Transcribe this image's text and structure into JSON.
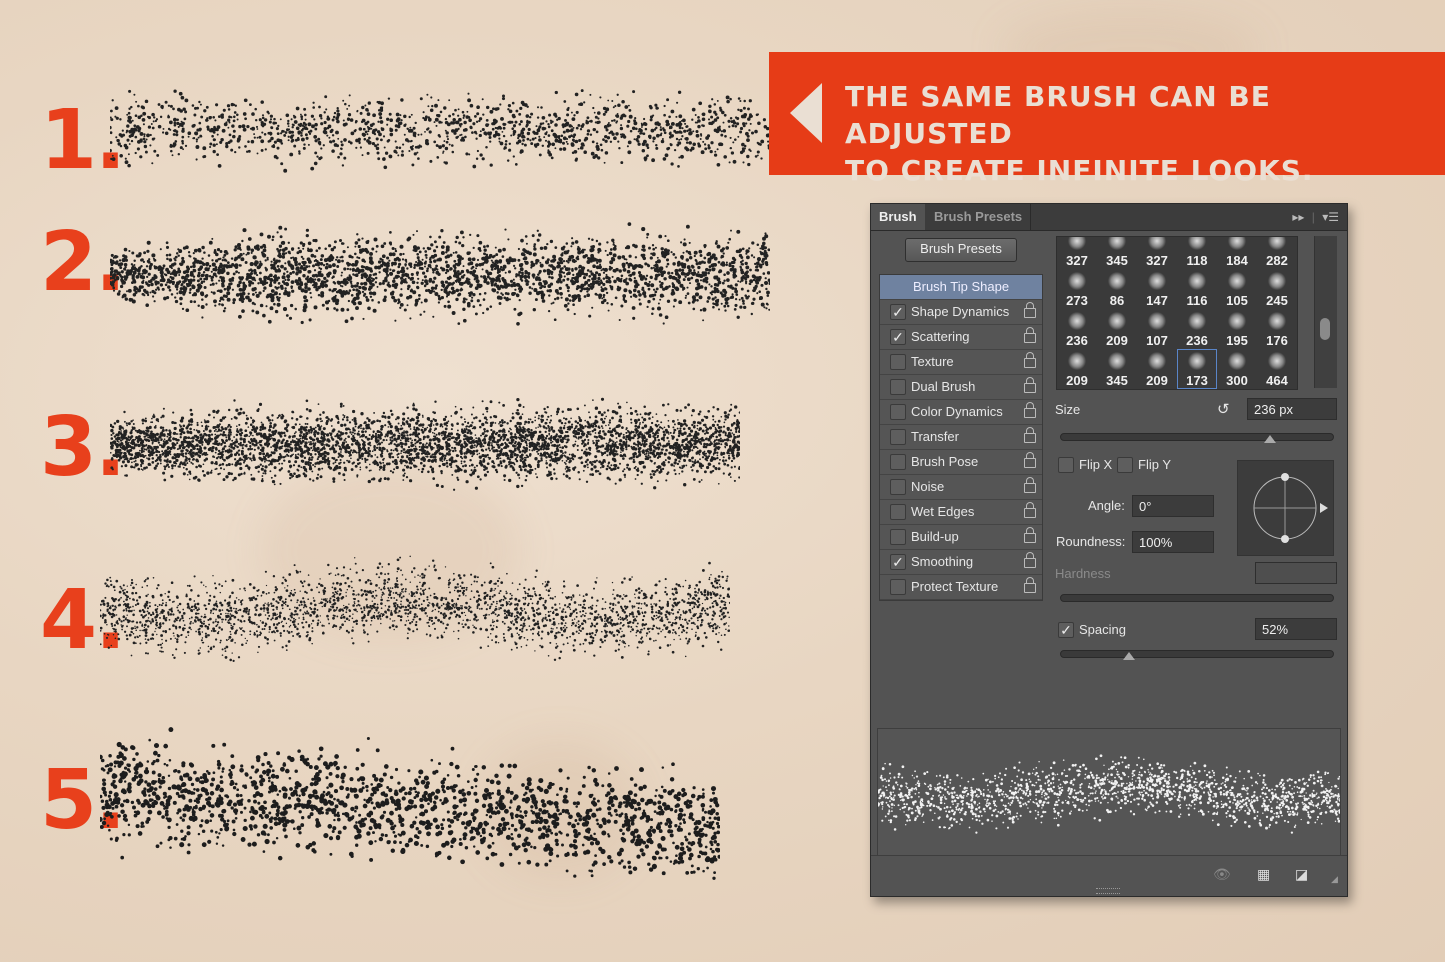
{
  "headline": {
    "line1": "The same brush can be adjusted",
    "line2": "to create infinite looks."
  },
  "samples": [
    {
      "label": "1."
    },
    {
      "label": "2."
    },
    {
      "label": "3."
    },
    {
      "label": "4."
    },
    {
      "label": "5."
    }
  ],
  "colors": {
    "accent": "#e63c17",
    "paper": "#e8d6c2",
    "panel_bg": "#535353",
    "selected_row": "#6f82a0"
  },
  "panel": {
    "tabs": [
      {
        "label": "Brush",
        "active": true
      },
      {
        "label": "Brush Presets",
        "active": false
      }
    ],
    "tab_icons": {
      "collapse": "double-arrow-icon",
      "menu": "panel-menu-icon"
    },
    "brush_presets_button": "Brush Presets",
    "options": [
      {
        "label": "Brush Tip Shape",
        "header": true
      },
      {
        "label": "Shape Dynamics",
        "checked": true
      },
      {
        "label": "Scattering",
        "checked": true
      },
      {
        "label": "Texture",
        "checked": false
      },
      {
        "label": "Dual Brush",
        "checked": false
      },
      {
        "label": "Color Dynamics",
        "checked": false
      },
      {
        "label": "Transfer",
        "checked": false
      },
      {
        "label": "Brush Pose",
        "checked": false
      },
      {
        "label": "Noise",
        "checked": false
      },
      {
        "label": "Wet Edges",
        "checked": false
      },
      {
        "label": "Build-up",
        "checked": false
      },
      {
        "label": "Smoothing",
        "checked": true
      },
      {
        "label": "Protect Texture",
        "checked": false
      }
    ],
    "tips": [
      [
        "327",
        "345",
        "327",
        "118",
        "184",
        "282"
      ],
      [
        "273",
        "86",
        "147",
        "116",
        "105",
        "245"
      ],
      [
        "236",
        "209",
        "107",
        "236",
        "195",
        "176"
      ],
      [
        "209",
        "345",
        "209",
        "173",
        "300",
        "464"
      ]
    ],
    "selected_tip": {
      "row": 3,
      "col": 3
    },
    "size_label": "Size",
    "size_value": "236 px",
    "size_slider_fraction": 0.77,
    "flip_x_label": "Flip X",
    "flip_x": false,
    "flip_y_label": "Flip Y",
    "flip_y": false,
    "angle_label": "Angle:",
    "angle_value": "0°",
    "roundness_label": "Roundness:",
    "roundness_value": "100%",
    "hardness_label": "Hardness",
    "hardness_value": "",
    "spacing_label": "Spacing",
    "spacing_checked": true,
    "spacing_value": "52%",
    "spacing_slider_fraction": 0.25,
    "footer_icons": [
      "toggle-live-tip-icon",
      "brush-preset-grid-icon",
      "new-preset-icon"
    ]
  }
}
